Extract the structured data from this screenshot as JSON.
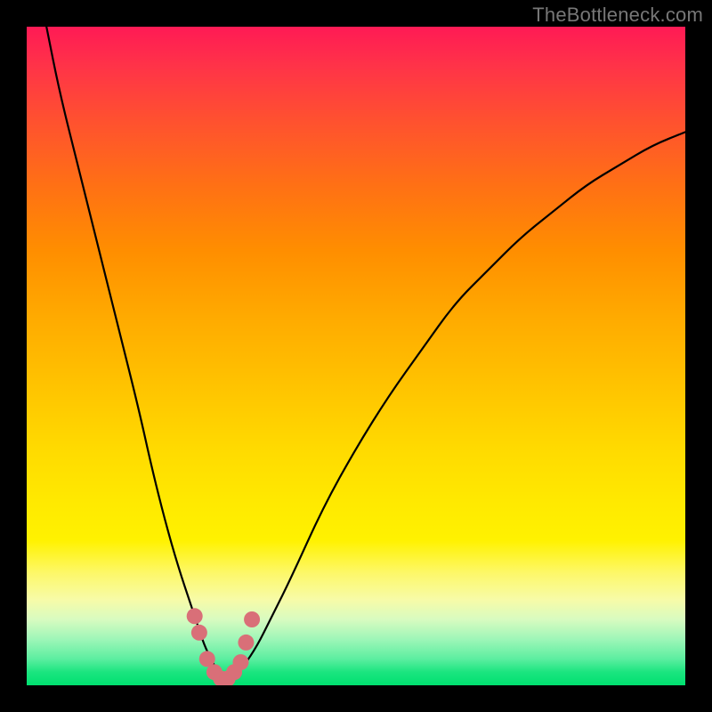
{
  "watermark": "TheBottleneck.com",
  "colors": {
    "frame": "#000000",
    "curve": "#000000",
    "marker": "#d96f78",
    "gradient_top": "#ff1a55",
    "gradient_bottom": "#00e070"
  },
  "chart_data": {
    "type": "line",
    "title": "",
    "xlabel": "",
    "ylabel": "",
    "xlim": [
      0,
      100
    ],
    "ylim": [
      0,
      100
    ],
    "axes_visible": false,
    "series": [
      {
        "name": "bottleneck-curve",
        "x": [
          3,
          5,
          8,
          11,
          14,
          17,
          19,
          21,
          23,
          25,
          26,
          27,
          28,
          29,
          30,
          31,
          32,
          33,
          35,
          37,
          40,
          45,
          50,
          55,
          60,
          65,
          70,
          75,
          80,
          85,
          90,
          95,
          100
        ],
        "y": [
          100,
          90,
          78,
          66,
          54,
          42,
          33,
          25,
          18,
          12,
          9,
          6,
          4,
          2,
          1,
          1,
          2,
          3,
          6,
          10,
          16,
          27,
          36,
          44,
          51,
          58,
          63,
          68,
          72,
          76,
          79,
          82,
          84
        ]
      }
    ],
    "markers": {
      "name": "highlight-points",
      "x": [
        25.5,
        26.2,
        27.4,
        28.5,
        29.5,
        30.5,
        31.5,
        32.5,
        33.3,
        34.2
      ],
      "y": [
        10.5,
        8.0,
        4.0,
        2.0,
        1.0,
        1.0,
        2.0,
        3.5,
        6.5,
        10.0
      ]
    }
  }
}
